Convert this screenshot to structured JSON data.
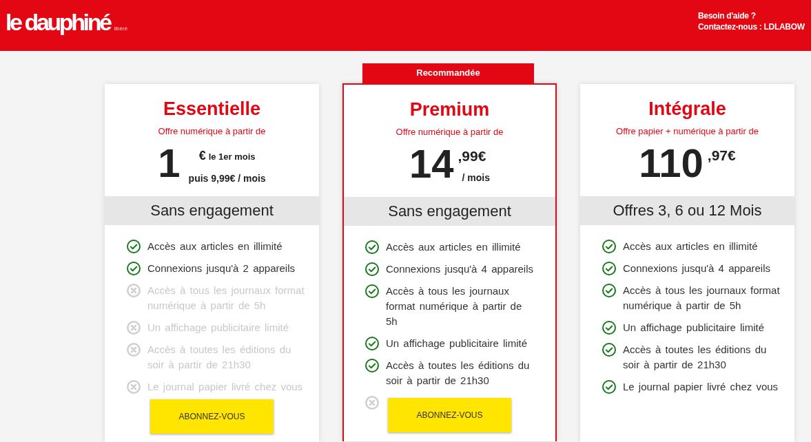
{
  "header": {
    "logo": "le dauphiné",
    "logo_tagline": "libéré",
    "help_title": "Besoin d'aide ?",
    "help_contact": "Contactez-nous : LDLABOW"
  },
  "plans": [
    {
      "name": "Essentielle",
      "recommended": false,
      "subtitle": "Offre numérique à partir de",
      "price": {
        "kind": "intro",
        "amount": "1",
        "currency": "€",
        "note": "le 1er mois",
        "after": "puis 9,99€ / mois"
      },
      "commitment": "Sans engagement",
      "features": [
        {
          "text": "Accès aux articles en illimité",
          "included": true
        },
        {
          "text": "Connexions jusqu'à 2 appareils",
          "included": true
        },
        {
          "text": "Accès à tous les journaux format numérique à partir de 5h",
          "included": false
        },
        {
          "text": "Un affichage publicitaire limité",
          "included": false
        },
        {
          "text": "Accès à toutes les éditions du soir à partir de 21h30",
          "included": false
        },
        {
          "text": "Le journal papier livré chez vous",
          "included": false
        }
      ],
      "button": "ABONNEZ-VOUS"
    },
    {
      "name": "Premium",
      "recommended": true,
      "badge": "Recommandée",
      "subtitle": "Offre numérique à partir de",
      "price": {
        "kind": "standard",
        "amount": "14",
        "cents": ",99€",
        "period": "/ mois"
      },
      "commitment": "Sans engagement",
      "features": [
        {
          "text": "Accès aux articles en illimité",
          "included": true
        },
        {
          "text": "Connexions jusqu'à 4 appareils",
          "included": true
        },
        {
          "text": "Accès à tous les journaux format numérique à partir de 5h",
          "included": true
        },
        {
          "text": "Un affichage publicitaire limité",
          "included": true
        },
        {
          "text": "Accès à toutes les éditions du soir à partir de 21h30",
          "included": true
        },
        {
          "included": false
        }
      ],
      "button": "ABONNEZ-VOUS"
    },
    {
      "name": "Intégrale",
      "recommended": false,
      "subtitle": "Offre papier + numérique à partir de",
      "price": {
        "kind": "standard",
        "amount": "110",
        "cents": ",97€"
      },
      "commitment": "Offres 3, 6 ou 12 Mois",
      "features": [
        {
          "text": "Accès aux articles en illimité",
          "included": true
        },
        {
          "text": "Connexions jusqu'à 4 appareils",
          "included": true
        },
        {
          "text": "Accès à tous les journaux format numérique à partir de 5h",
          "included": true
        },
        {
          "text": "Un affichage publicitaire limité",
          "included": true
        },
        {
          "text": "Accès à toutes les éditions du soir à partir de 21h30",
          "included": true
        },
        {
          "text": "Le journal papier livré chez vous",
          "included": true
        }
      ]
    }
  ]
}
